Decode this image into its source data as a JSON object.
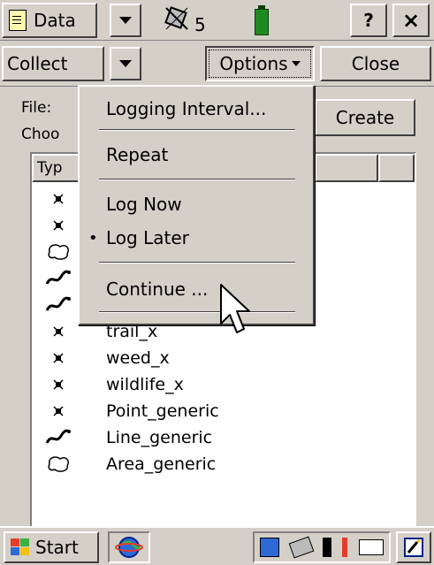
{
  "titlebar": {
    "app_label": "Data",
    "satellite_count": "5",
    "help_label": "?",
    "close_label": "×"
  },
  "toolbar": {
    "mode_label": "Collect",
    "options_label": "Options",
    "close_label": "Close"
  },
  "form": {
    "file_label": "File:",
    "choose_label": "Choo",
    "create_label": "Create",
    "column_type": "Typ"
  },
  "menu": {
    "items": [
      "Logging Interval...",
      "Repeat",
      "Log Now",
      "Log Later",
      "Continue ..."
    ],
    "bullet": "•"
  },
  "features": [
    {
      "icon": "point-icon",
      "name": ""
    },
    {
      "icon": "point-icon",
      "name": ""
    },
    {
      "icon": "area-icon",
      "name": ""
    },
    {
      "icon": "line-icon",
      "name": ""
    },
    {
      "icon": "line-icon",
      "name": ""
    },
    {
      "icon": "point-icon",
      "name": "trail_x"
    },
    {
      "icon": "point-icon",
      "name": "weed_x"
    },
    {
      "icon": "point-icon",
      "name": "wildlife_x"
    },
    {
      "icon": "point-icon",
      "name": "Point_generic"
    },
    {
      "icon": "line-icon",
      "name": "Line_generic"
    },
    {
      "icon": "area-icon",
      "name": "Area_generic"
    }
  ],
  "taskbar": {
    "start_label": "Start"
  },
  "colors": {
    "battery": "#1f8a1f",
    "battery_top": "#0b3d0b",
    "surface": "#d4d0c8"
  }
}
